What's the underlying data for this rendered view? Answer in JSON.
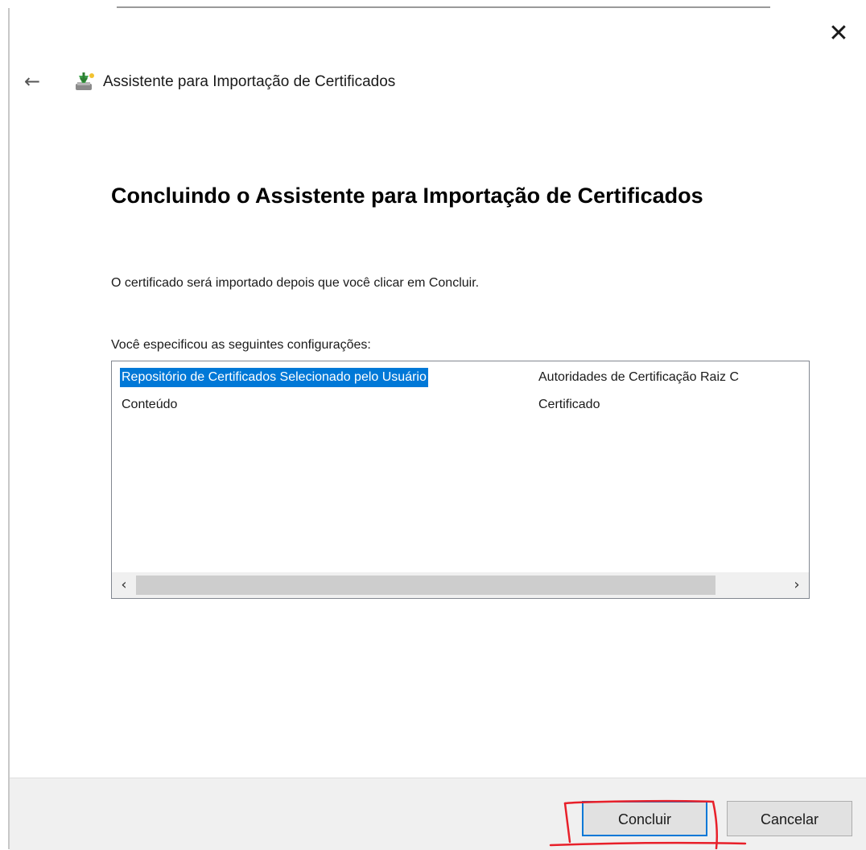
{
  "window": {
    "title": "Assistente para Importação de Certificados",
    "close_glyph": "✕",
    "back_glyph": "←"
  },
  "page": {
    "heading": "Concluindo o Assistente para Importação de Certificados",
    "description": "O certificado será importado depois que você clicar em Concluir.",
    "settings_label": "Você especificou as seguintes configurações:"
  },
  "settings_list": {
    "rows": [
      {
        "name": "Repositório de Certificados Selecionado pelo Usuário",
        "value": "Autoridades de Certificação Raiz C"
      },
      {
        "name": "Conteúdo",
        "value": "Certificado"
      }
    ],
    "scroll_left_glyph": "‹",
    "scroll_right_glyph": "›"
  },
  "footer": {
    "finish_label": "Concluir",
    "cancel_label": "Cancelar"
  },
  "colors": {
    "selection": "#0078d7",
    "annotation": "#e8202a",
    "footer_bg": "#f0f0f0"
  },
  "icons": {
    "wizard": "certificate-wizard-icon",
    "close": "close-icon",
    "back": "back-arrow-icon"
  }
}
